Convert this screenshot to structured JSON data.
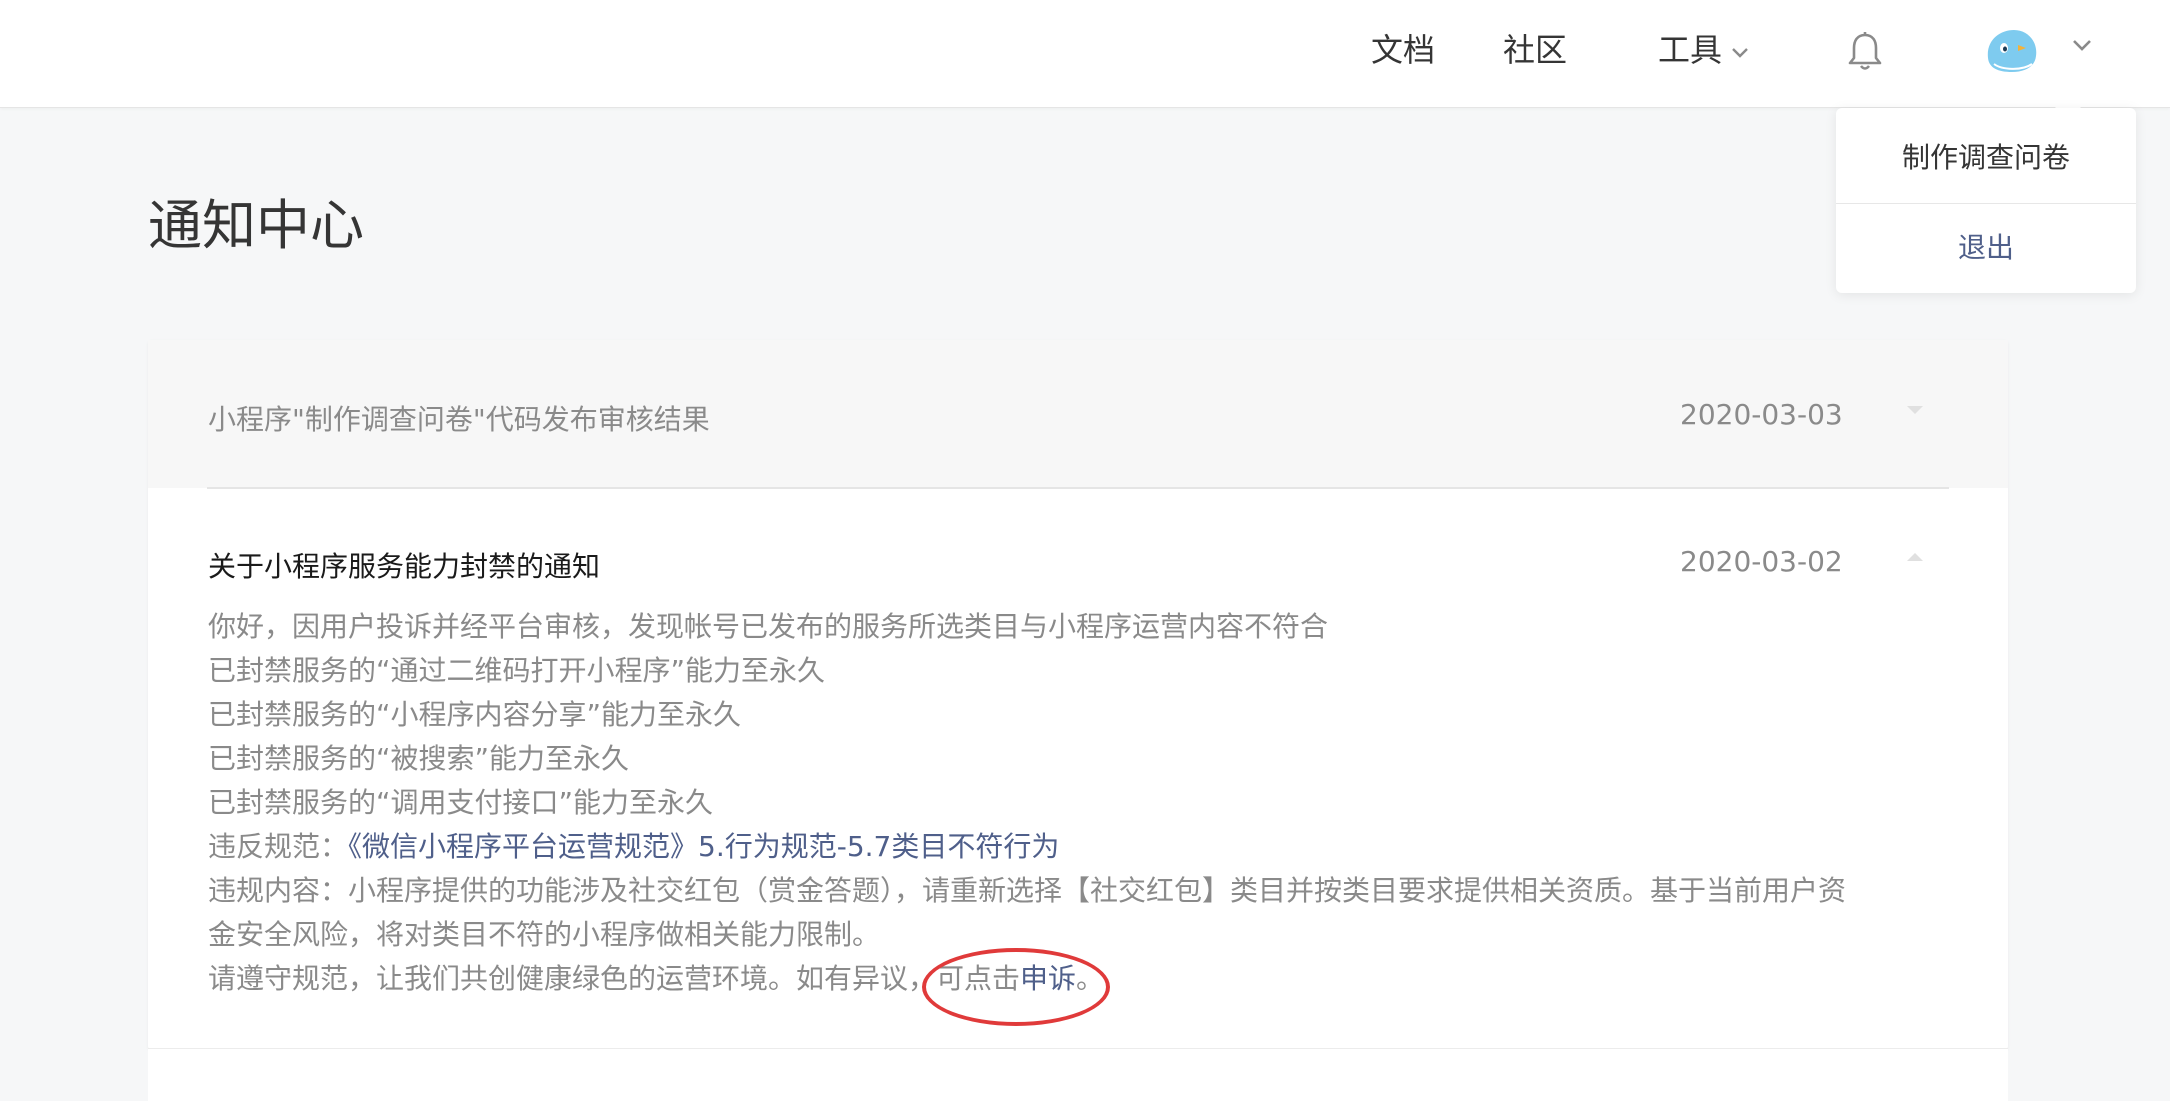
{
  "header": {
    "nav": {
      "docs": "文档",
      "community": "社区",
      "tools": "工具"
    },
    "icons": {
      "tools_chevron": "chevron-down-icon",
      "bell": "bell-icon",
      "avatar": "avatar-icon",
      "avatar_chevron": "chevron-down-icon"
    }
  },
  "dropdown": {
    "survey": "制作调查问卷",
    "logout": "退出"
  },
  "page": {
    "title": "通知中心"
  },
  "notifications": [
    {
      "title": "小程序\"制作调查问卷\"代码发布审核结果",
      "date": "2020-03-03",
      "expanded": false
    },
    {
      "title": "关于小程序服务能力封禁的通知",
      "date": "2020-03-02",
      "expanded": true,
      "body": {
        "line1": "你好，因用户投诉并经平台审核，发现帐号已发布的服务所选类目与小程序运营内容不符合",
        "line2": "已封禁服务的“通过二维码打开小程序”能力至永久",
        "line3": "已封禁服务的“小程序内容分享”能力至永久",
        "line4": "已封禁服务的“被搜索”能力至永久",
        "line5": "已封禁服务的“调用支付接口”能力至永久",
        "violation_prefix": "违反规范：",
        "violation_link": "《微信小程序平台运营规范》5.行为规范-5.7类目不符行为",
        "content": "违规内容：小程序提供的功能涉及社交红包（赏金答题），请重新选择【社交红包】类目并按类目要求提供相关资质。基于当前用户资金安全风险，将对类目不符的小程序做相关能力限制。",
        "closing_prefix": "请遵守规范，让我们共创健康绿色的运营环境。如有异议，可点击",
        "appeal_link": "申诉",
        "closing_suffix": "。"
      }
    }
  ],
  "colors": {
    "accent_link": "#4f5f8a",
    "highlight_ring": "#e03a3a",
    "muted_text": "#8a8a8a"
  }
}
